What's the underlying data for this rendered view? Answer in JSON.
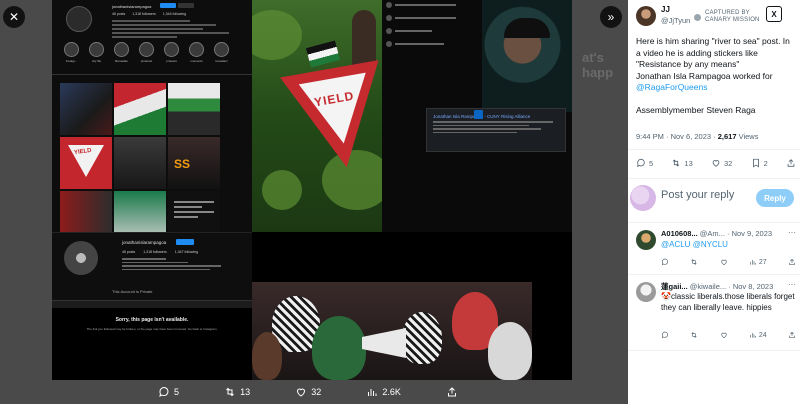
{
  "viewer": {
    "close_icon": "close-icon",
    "expand_icon": "chevron-double-right-icon",
    "background_caption": "at's happ",
    "actions": {
      "replies": "5",
      "retweets": "13",
      "likes": "32",
      "views": "2.6K"
    }
  },
  "collage": {
    "instagram_profile": {
      "username": "jonathanislarampagoa",
      "stats": [
        "46 posts",
        "1,318 followers",
        "1,044 following"
      ],
      "highlights": [
        "Instagr...",
        "city life",
        "Ramadan",
        "pinterest",
        "protests",
        "moments",
        "ramadan!"
      ]
    },
    "yield_sign_text": "YIELD",
    "tile_text": "SS",
    "linkedin": {
      "title": "Jonathan Isla Rampagoa - CUNY Rising Alliance"
    },
    "private_profile": {
      "username": "jonathanislarampagoa",
      "stats": [
        "46 posts",
        "1,318 followers",
        "1,047 following"
      ],
      "private_notice": "This Account is Private"
    },
    "unavailable": {
      "heading": "Sorry, this page isn't available.",
      "body": "The link you followed may be broken, or the page may have been removed. Go back to Instagram."
    }
  },
  "tweet": {
    "author_name": "JJ",
    "author_handle": "@JjTyun",
    "badge_line1": "CAPTURED BY",
    "badge_line2": "CANARY MISSION",
    "logo": "X",
    "text_line1": "Here is him sharing \"river to sea\" post. In a video he is adding stickers like \"Resistance by any means\"",
    "text_line2": "Jonathan Isla Rampagoa worked for",
    "mention": "@RagaForQueens",
    "text_line3": "Assemblymember Steven Raga",
    "time": "9:44 PM · Nov 6, 2023 · ",
    "views_count": "2,617",
    "views_label": " Views",
    "actions": {
      "replies": "5",
      "retweets": "13",
      "likes": "32",
      "bookmarks": "2"
    }
  },
  "reply_box": {
    "placeholder": "Post your reply",
    "button": "Reply"
  },
  "replies": [
    {
      "name": "A010608...",
      "handle": "@Am...",
      "date": "· Nov 9, 2023",
      "mention1": "@ACLU",
      "mention2": "@NYCLU",
      "views": "27"
    },
    {
      "name": "蓮gaii...",
      "handle": "@kiwaile...",
      "date": "· Nov 8, 2023",
      "emoji": "🤡",
      "text": "classic liberals.those liberals forget they can liberally leave. hippies",
      "views": "24"
    }
  ]
}
